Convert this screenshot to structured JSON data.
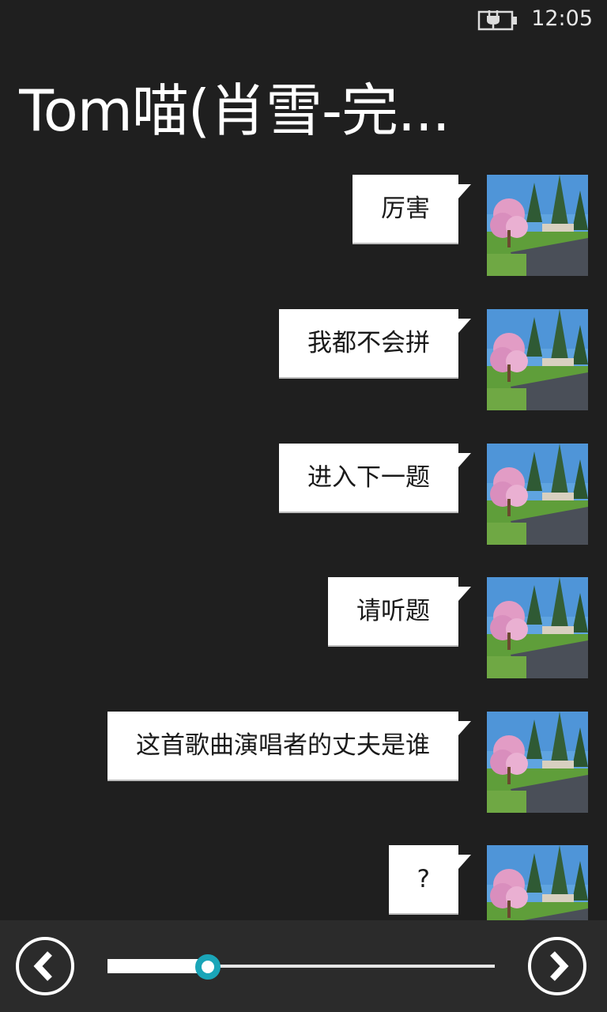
{
  "status_bar": {
    "time": "12:05",
    "battery_icon": "battery-charging-icon"
  },
  "header": {
    "title": "Tom喵(肖雪-完..."
  },
  "messages": [
    {
      "text": "厉害",
      "avatar": "landscape-photo-avatar"
    },
    {
      "text": "我都不会拼",
      "avatar": "landscape-photo-avatar"
    },
    {
      "text": "进入下一题",
      "avatar": "landscape-photo-avatar"
    },
    {
      "text": "请听题",
      "avatar": "landscape-photo-avatar"
    },
    {
      "text": "这首歌曲演唱者的丈夫是谁",
      "avatar": "landscape-photo-avatar"
    },
    {
      "text": "?",
      "avatar": "landscape-photo-avatar"
    }
  ],
  "app_bar": {
    "prev_icon": "chevron-left-icon",
    "next_icon": "chevron-right-icon",
    "progress": 0.26
  },
  "colors": {
    "background": "#1f1f1f",
    "app_bar": "#2b2b2b",
    "bubble": "#ffffff",
    "accent": "#1aa5b8"
  }
}
